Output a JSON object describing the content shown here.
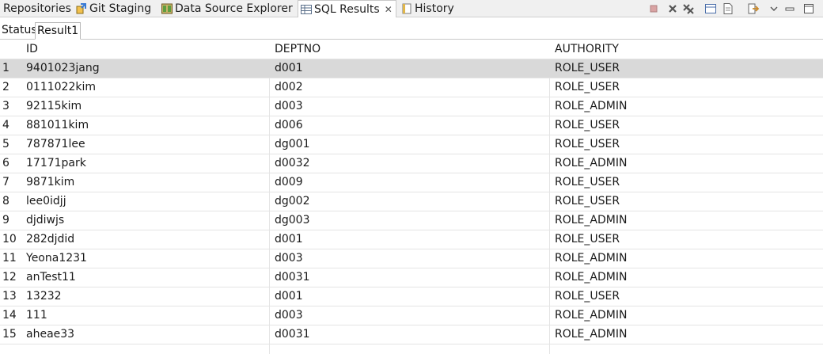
{
  "view_tabs": [
    {
      "label": "Repositories",
      "icon": "repositories-icon"
    },
    {
      "label": "Git Staging",
      "icon": "git-staging-icon"
    },
    {
      "label": "Data Source Explorer",
      "icon": "data-source-explorer-icon"
    },
    {
      "label": "SQL Results",
      "icon": "sql-results-icon",
      "active": true
    },
    {
      "label": "History",
      "icon": "history-icon"
    }
  ],
  "result_tabs": [
    {
      "label": "Status"
    },
    {
      "label": "Result1",
      "active": true
    }
  ],
  "table": {
    "columns": [
      "ID",
      "DEPTNO",
      "AUTHORITY"
    ],
    "rows": [
      {
        "n": "1",
        "id": "9401023jang",
        "deptno": "d001",
        "authority": "ROLE_USER"
      },
      {
        "n": "2",
        "id": "0111022kim",
        "deptno": "d002",
        "authority": "ROLE_USER"
      },
      {
        "n": "3",
        "id": "92115kim",
        "deptno": "d003",
        "authority": "ROLE_ADMIN"
      },
      {
        "n": "4",
        "id": "881011kim",
        "deptno": "d006",
        "authority": "ROLE_USER"
      },
      {
        "n": "5",
        "id": "787871lee",
        "deptno": "dg001",
        "authority": "ROLE_USER"
      },
      {
        "n": "6",
        "id": "17171park",
        "deptno": "d0032",
        "authority": "ROLE_ADMIN"
      },
      {
        "n": "7",
        "id": "9871kim",
        "deptno": "d009",
        "authority": "ROLE_USER"
      },
      {
        "n": "8",
        "id": "lee0idjj",
        "deptno": "dg002",
        "authority": "ROLE_USER"
      },
      {
        "n": "9",
        "id": "djdiwjs",
        "deptno": "dg003",
        "authority": "ROLE_ADMIN"
      },
      {
        "n": "10",
        "id": "282djdid",
        "deptno": "d001",
        "authority": "ROLE_USER"
      },
      {
        "n": "11",
        "id": "Yeona1231",
        "deptno": "d003",
        "authority": "ROLE_ADMIN"
      },
      {
        "n": "12",
        "id": "anTest11",
        "deptno": "d0031",
        "authority": "ROLE_ADMIN"
      },
      {
        "n": "13",
        "id": "13232",
        "deptno": "d001",
        "authority": "ROLE_USER"
      },
      {
        "n": "14",
        "id": "111",
        "deptno": "d003",
        "authority": "ROLE_ADMIN"
      },
      {
        "n": "15",
        "id": "aheae33",
        "deptno": "d0031",
        "authority": "ROLE_ADMIN"
      }
    ],
    "selected_row": 1
  },
  "colors": {
    "selected_row": "#d9d9d9",
    "grid_line": "#e4e4e4",
    "view_bar": "#f0f0f0"
  }
}
